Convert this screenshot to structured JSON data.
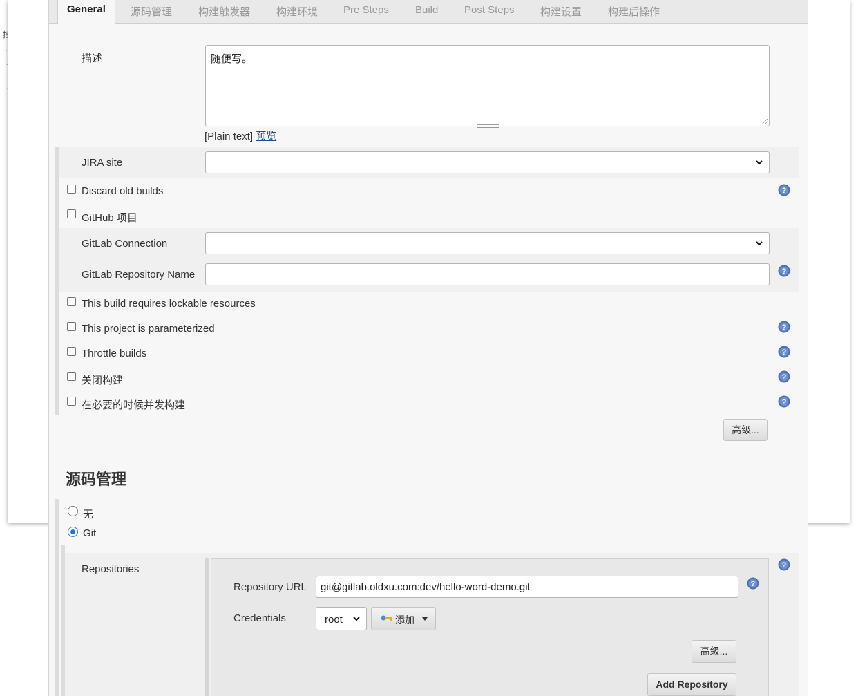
{
  "background": {
    "left_char": "拙"
  },
  "tabs": [
    {
      "label": "General",
      "active": true
    },
    {
      "label": "源码管理"
    },
    {
      "label": "构建触发器"
    },
    {
      "label": "构建环境"
    },
    {
      "label": "Pre Steps"
    },
    {
      "label": "Build"
    },
    {
      "label": "Post Steps"
    },
    {
      "label": "构建设置"
    },
    {
      "label": "构建后操作"
    }
  ],
  "general": {
    "description_label": "描述",
    "description_value": "随便写。",
    "plain_text": "[Plain text]",
    "preview_link": "预览",
    "jira_label": "JIRA site",
    "jira_value": "",
    "discard_label": "Discard old builds",
    "github_label": "GitHub 项目",
    "gitlab_connection_label": "GitLab Connection",
    "gitlab_connection_value": "",
    "gitlab_repo_label": "GitLab Repository Name",
    "gitlab_repo_value": "",
    "lockable_label": "This build requires lockable resources",
    "parameterized_label": "This project is parameterized",
    "throttle_label": "Throttle builds",
    "disable_label": "关闭构建",
    "concurrent_label": "在必要的时候并发构建",
    "advanced_button": "高级..."
  },
  "scm": {
    "title": "源码管理",
    "none_label": "无",
    "git_label": "Git",
    "selected": "Git",
    "repositories_label": "Repositories",
    "repo_url_label": "Repository URL",
    "repo_url_value": "git@gitlab.oldxu.com:dev/hello-word-demo.git",
    "credentials_label": "Credentials",
    "credentials_value": "root",
    "add_button": "添加",
    "advanced_button": "高级...",
    "add_repository_button": "Add Repository"
  },
  "colors": {
    "help_icon": "#4a6fb5",
    "link": "#204a87",
    "radio_checked": "#1a73e8"
  }
}
